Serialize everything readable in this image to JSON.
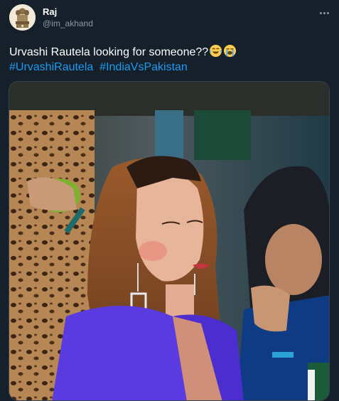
{
  "author": {
    "display_name": "Raj",
    "handle": "@im_akhand",
    "avatar_icon": "lion-capital-emblem-icon"
  },
  "tweet": {
    "text": "Urvashi Rautela looking for someone??",
    "emojis": [
      "face-with-tears-of-joy-icon",
      "loudly-crying-face-icon"
    ],
    "hashtags": [
      "#UrvashiRautela",
      "#IndiaVsPakistan"
    ]
  },
  "media": {
    "description_icon": "photo"
  },
  "colors": {
    "background": "#15202b",
    "text": "#ffffff",
    "secondary_text": "#8b98a5",
    "link": "#1d9bf0",
    "border": "#38444d"
  }
}
